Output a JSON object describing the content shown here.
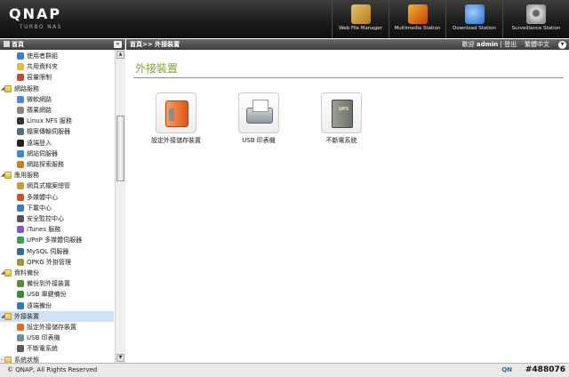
{
  "header": {
    "logo": "QNAP",
    "logo_sub": "TURBO NAS",
    "apps": [
      {
        "label": "Web File Manager",
        "icon": "folder-magnifier-icon"
      },
      {
        "label": "Multimedia Station",
        "icon": "multimedia-icon"
      },
      {
        "label": "Download Station",
        "icon": "download-icon"
      },
      {
        "label": "Surveillance Station",
        "icon": "camera-icon"
      }
    ]
  },
  "sidebar": {
    "title": "首頁",
    "collapse": "«",
    "items": [
      {
        "label": "使用者群組",
        "level": 2,
        "icon": "group-icon",
        "color": "#3b7dd8"
      },
      {
        "label": "共用資料夾",
        "level": 2,
        "icon": "folder-icon",
        "color": "#e8b83a"
      },
      {
        "label": "容量限制",
        "level": 2,
        "icon": "quota-icon",
        "color": "#c84a3a"
      },
      {
        "label": "網路服務",
        "level": 1,
        "icon": "category-folder-icon",
        "expanded": true
      },
      {
        "label": "微軟網路",
        "level": 2,
        "icon": "windows-icon",
        "color": "#4a86d8"
      },
      {
        "label": "蘋果網路",
        "level": 2,
        "icon": "apple-icon",
        "color": "#888888"
      },
      {
        "label": "Linux NFS 服務",
        "level": 2,
        "icon": "linux-icon",
        "color": "#333333"
      },
      {
        "label": "檔案傳輸伺服器",
        "level": 2,
        "icon": "ftp-icon",
        "color": "#5a6a7a"
      },
      {
        "label": "遠端登入",
        "level": 2,
        "icon": "telnet-icon",
        "color": "#222222"
      },
      {
        "label": "網站伺服器",
        "level": 2,
        "icon": "web-server-icon",
        "color": "#3a8ad0"
      },
      {
        "label": "網路探索服務",
        "level": 2,
        "icon": "discovery-icon",
        "color": "#d07a2a"
      },
      {
        "label": "應用服務",
        "level": 1,
        "icon": "category-folder-icon",
        "expanded": true
      },
      {
        "label": "網頁式檔案總管",
        "level": 2,
        "icon": "web-file-icon",
        "color": "#c89a3a"
      },
      {
        "label": "多媒體中心",
        "level": 2,
        "icon": "multimedia-icon",
        "color": "#d0502a"
      },
      {
        "label": "下載中心",
        "level": 2,
        "icon": "download-icon",
        "color": "#3a7ad0"
      },
      {
        "label": "安全監控中心",
        "level": 2,
        "icon": "camera-icon",
        "color": "#555555"
      },
      {
        "label": "iTunes 服務",
        "level": 2,
        "icon": "itunes-icon",
        "color": "#7a5ad0"
      },
      {
        "label": "UPnP 多媒體伺服器",
        "level": 2,
        "icon": "upnp-icon",
        "color": "#3a9a5a"
      },
      {
        "label": "MySQL 伺服器",
        "level": 2,
        "icon": "mysql-icon",
        "color": "#3a6a9a"
      },
      {
        "label": "QPKG 外掛管理",
        "level": 2,
        "icon": "qpkg-icon",
        "color": "#9a9a3a"
      },
      {
        "label": "資料備份",
        "level": 1,
        "icon": "category-folder-icon",
        "expanded": true
      },
      {
        "label": "備份到外接裝置",
        "level": 2,
        "icon": "backup-external-icon",
        "color": "#5a8a3a"
      },
      {
        "label": "USB 單鍵備份",
        "level": 2,
        "icon": "usb-backup-icon",
        "color": "#3a8a3a"
      },
      {
        "label": "遠端備份",
        "level": 2,
        "icon": "remote-backup-icon",
        "color": "#3a7ab0"
      },
      {
        "label": "外接裝置",
        "level": 1,
        "icon": "category-folder-icon",
        "expanded": true,
        "selected": true
      },
      {
        "label": "設定外接儲存裝置",
        "level": 2,
        "icon": "external-storage-icon",
        "color": "#e06a2a"
      },
      {
        "label": "USB 印表機",
        "level": 2,
        "icon": "printer-icon",
        "color": "#7a8a9a"
      },
      {
        "label": "不斷電系統",
        "level": 2,
        "icon": "ups-icon",
        "color": "#5a5a5a"
      },
      {
        "label": "系統狀態",
        "level": 1,
        "icon": "category-folder-icon",
        "expanded": false
      }
    ]
  },
  "topbar": {
    "breadcrumb": "首頁>> 外接裝置",
    "welcome_prefix": "歡迎 ",
    "username": "admin",
    "separator": " | ",
    "logout": "登出",
    "language": "繁體中文"
  },
  "main": {
    "title": "外接裝置",
    "tiles": [
      {
        "label": "設定外接儲存裝置",
        "icon": "external-storage-icon"
      },
      {
        "label": "USB 印表機",
        "icon": "printer-icon"
      },
      {
        "label": "不斷電系統",
        "icon": "ups-icon"
      }
    ]
  },
  "footer": {
    "copyright": "© QNAP, All Rights Reserved",
    "right_text": "QN",
    "watermark": "#488076"
  }
}
